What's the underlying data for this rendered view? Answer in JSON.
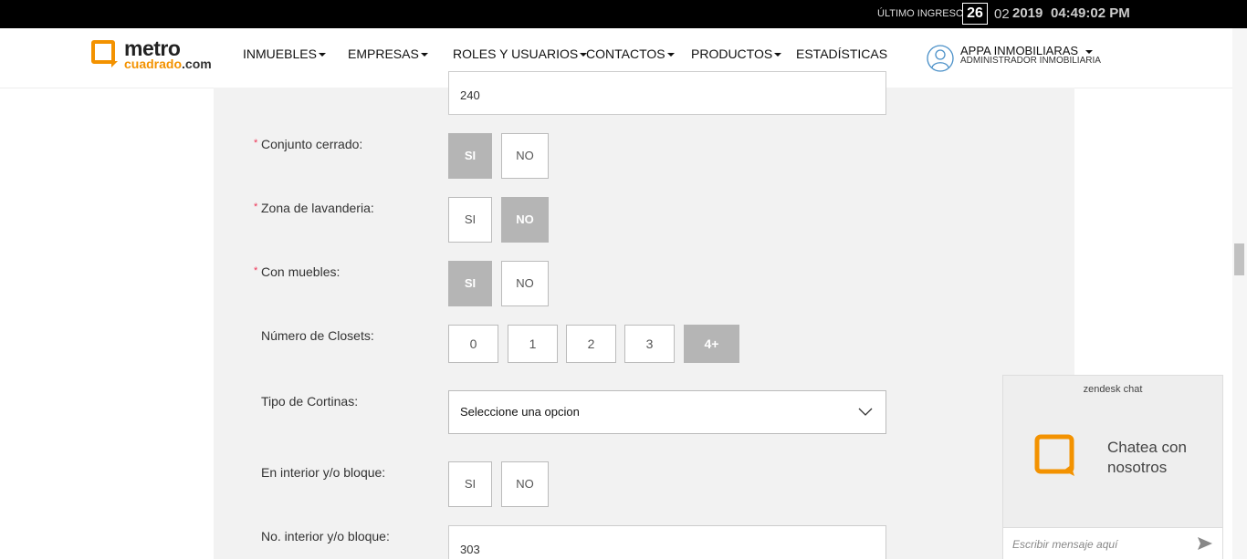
{
  "topbar": {
    "last_login_label": "ÚLTIMO INGRESO",
    "day": "26",
    "month": "02",
    "year": "2019",
    "time": "04:49:02 PM"
  },
  "header": {
    "logo_top": "metro",
    "logo_bottom": "cuadrado",
    "logo_suffix": ".com",
    "nav": [
      {
        "label": "INMUEBLES",
        "dropdown": true
      },
      {
        "label": "EMPRESAS",
        "dropdown": true
      },
      {
        "label": "ROLES Y USUARIOS",
        "dropdown": true
      },
      {
        "label": "CONTACTOS",
        "dropdown": true
      },
      {
        "label": "PRODUCTOS",
        "dropdown": true
      },
      {
        "label": "ESTADÍSTICAS",
        "dropdown": false
      }
    ],
    "user_name": "APPA INMOBILIARAS",
    "user_role": "ADMINISTRADOR INMOBILIARIA"
  },
  "form": {
    "area_value": "240",
    "conjunto_label": "Conjunto cerrado:",
    "lavanderia_label": "Zona de lavanderia:",
    "muebles_label": "Con muebles:",
    "closets_label": "Número de Closets:",
    "cortinas_label": "Tipo de Cortinas:",
    "interior_label": "En interior y/o bloque:",
    "no_interior_label": "No. interior y/o bloque:",
    "no_interior_value": "303",
    "yes": "SI",
    "no": "NO",
    "required_mark": "*",
    "closet_options": [
      "0",
      "1",
      "2",
      "3",
      "4+"
    ],
    "closets_selected": "4+",
    "conjunto_selected": "SI",
    "lavanderia_selected": "NO",
    "muebles_selected": "SI",
    "cortinas_value": "Seleccione una opcion"
  },
  "chat": {
    "brand": "zendesk chat",
    "cta_line1": "Chatea con",
    "cta_line2": "nosotros",
    "placeholder": "Escribir mensaje aquí"
  },
  "colors": {
    "accent": "#f39200",
    "selected_option": "#b5b5b5",
    "panel_bg": "#f2f2f2"
  }
}
